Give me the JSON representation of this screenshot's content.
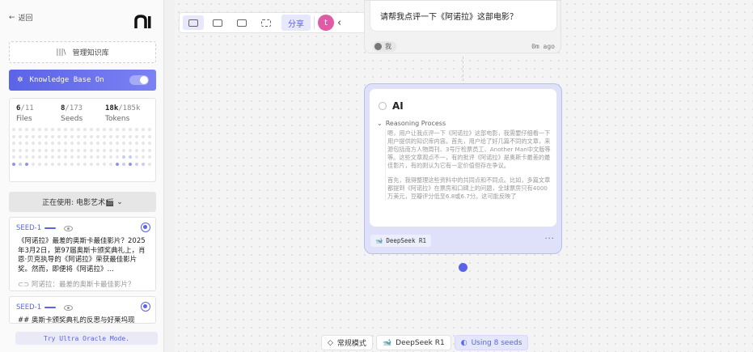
{
  "sidebar": {
    "back_label": "返回",
    "kb_manage_label": "管理知识库",
    "kb_toggle_label": "Knowledge Base On",
    "stats": [
      {
        "value": "6",
        "total": "/11",
        "label": "Files"
      },
      {
        "value": "8",
        "total": "/173",
        "label": "Seeds"
      },
      {
        "value": "18k",
        "total": "/185k",
        "label": "Tokens"
      }
    ],
    "using_label": "正在使用: 电影艺术🎬",
    "seeds": [
      {
        "id": "SEED-1",
        "text": "《阿诺拉》最差的奥斯卡最佳影片？2025年3月2日，第97届奥斯卡颁奖典礼上，肖恩·贝克执导的《阿诺拉》荣获最佳影片奖。然而，即便将《阿诺拉》…",
        "source": "阿诺拉：最差的奥斯卡最佳影片？"
      },
      {
        "id": "SEED-1",
        "text": "## 奥斯卡颁奖典礼的反思与好莱坞现",
        "source": ""
      }
    ],
    "oracle_label": "Try Ultra Oracle Mode."
  },
  "toolbar": {
    "share_label": "分享",
    "avatar_letter": "t"
  },
  "user_node": {
    "message": "请帮我点评一下《阿诺拉》这部电影？",
    "author": "我",
    "time": "0m ago"
  },
  "ai_node": {
    "title": "AI",
    "reasoning_header": "Reasoning Process",
    "reasoning_p1": "嗯，用户让我点评一下《阿诺拉》这部电影，我需要仔细看一下用户提供的知识库内容。首先，用户给了好几篇不同的文章，来源包括南方人物周刊、3号厅检票员工、Another Man中文版等等。这些文章观点不一，有的批评《阿诺拉》是奥斯卡最差的最佳影片，有的则认为它有一定价值但存在争议。",
    "reasoning_p2": "首先，我得整理这些资料中的共同点和不同点。比如，多篇文章都提到《阿诺拉》在票房和口碑上的问题，全球票房只有4000万美元，豆瓣评分低至6.8或6.7分。这可能反映了",
    "model": "DeepSeek R1"
  },
  "bottom_bar": {
    "mode_label": "常规模式",
    "model_label": "DeepSeek R1",
    "seeds_label": "Using 8 seeds"
  },
  "colors": {
    "accent": "#5b63e8",
    "avatar": "#e05aa6"
  }
}
